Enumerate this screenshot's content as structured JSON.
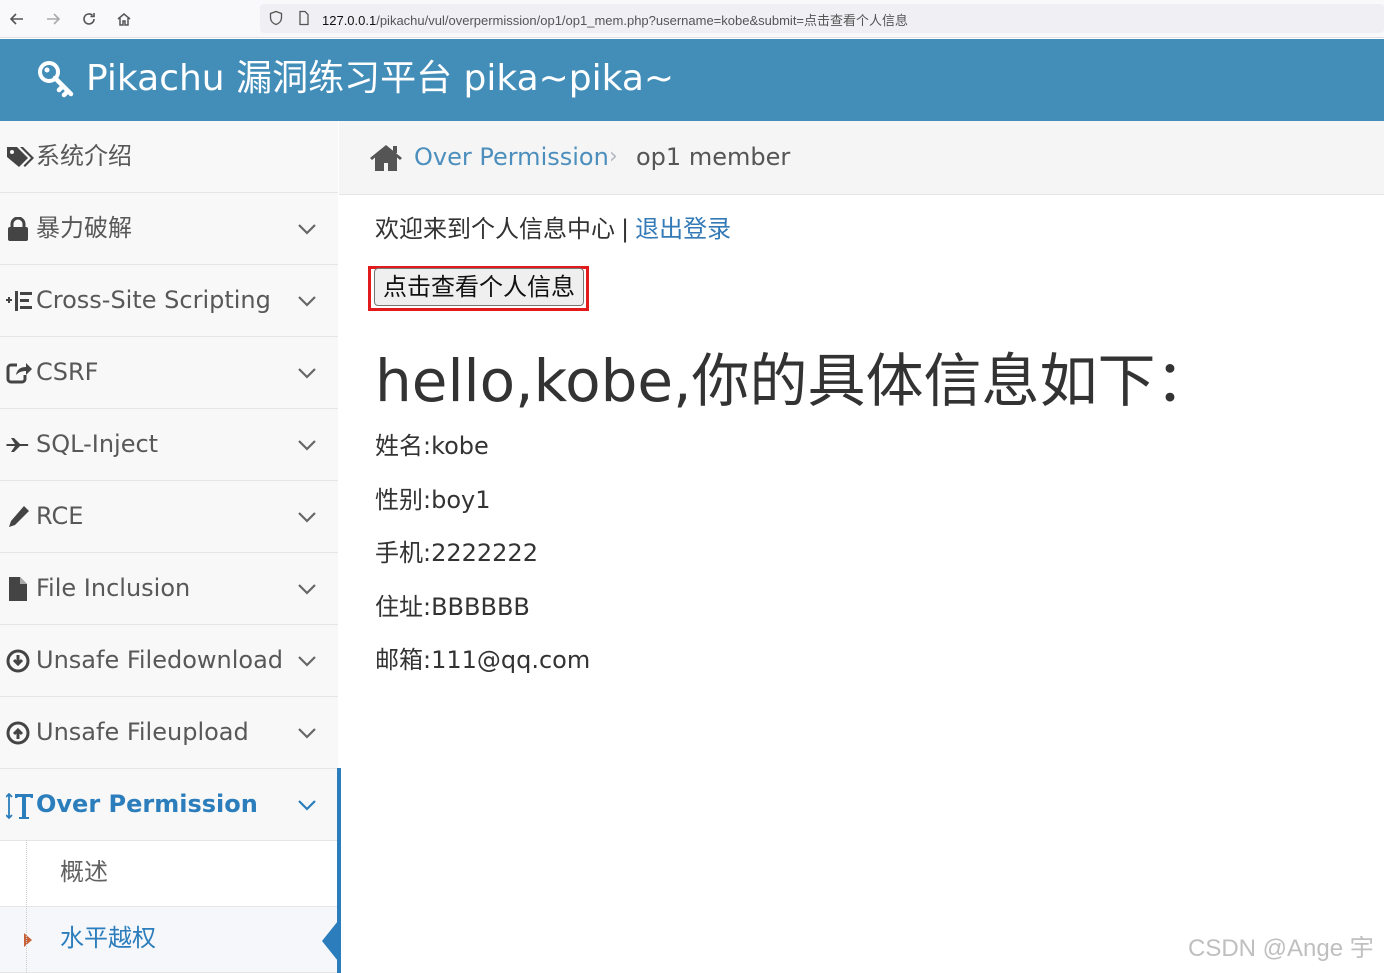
{
  "browser": {
    "url_host": "127.0.0.1",
    "url_path": "/pikachu/vul/overpermission/op1/op1_mem.php?username=kobe&submit=点击查看个人信息"
  },
  "header": {
    "title": "Pikachu 漏洞练习平台 pika~pika~",
    "icon": "key-icon"
  },
  "sidebar": {
    "items": [
      {
        "label": "系统介绍",
        "icon": "tags-icon",
        "expandable": false
      },
      {
        "label": "暴力破解",
        "icon": "lock-icon",
        "expandable": true
      },
      {
        "label": "Cross-Site Scripting",
        "icon": "list-icon",
        "expandable": true
      },
      {
        "label": "CSRF",
        "icon": "share-icon",
        "expandable": true
      },
      {
        "label": "SQL-Inject",
        "icon": "plane-icon",
        "expandable": true
      },
      {
        "label": "RCE",
        "icon": "pencil-icon",
        "expandable": true
      },
      {
        "label": "File Inclusion",
        "icon": "file-icon",
        "expandable": true
      },
      {
        "label": "Unsafe Filedownload",
        "icon": "download-icon",
        "expandable": true
      },
      {
        "label": "Unsafe Fileupload",
        "icon": "upload-icon",
        "expandable": true
      },
      {
        "label": "Over Permission",
        "icon": "text-height-icon",
        "expandable": true,
        "active": true
      }
    ],
    "subitems": [
      {
        "label": "概述"
      },
      {
        "label": "水平越权",
        "current": true
      }
    ],
    "accent_color": "#2b7dbc"
  },
  "breadcrumb": {
    "link": "Over Permission",
    "separator": "›",
    "current": "op1 member"
  },
  "main": {
    "welcome_text": "欢迎来到个人信息中心",
    "divider": "|",
    "logout_label": "退出登录",
    "view_button_label": "点击查看个人信息",
    "hello_text": "hello,kobe,你的具体信息如下：",
    "info_lines": [
      "姓名:kobe",
      "性别:boy1",
      "手机:2222222",
      "住址:BBBBBB",
      "邮箱:111@qq.com"
    ],
    "highlight_color": "#e31a1c"
  },
  "watermark": "CSDN @Ange 宇",
  "header_color": "#438eb9"
}
